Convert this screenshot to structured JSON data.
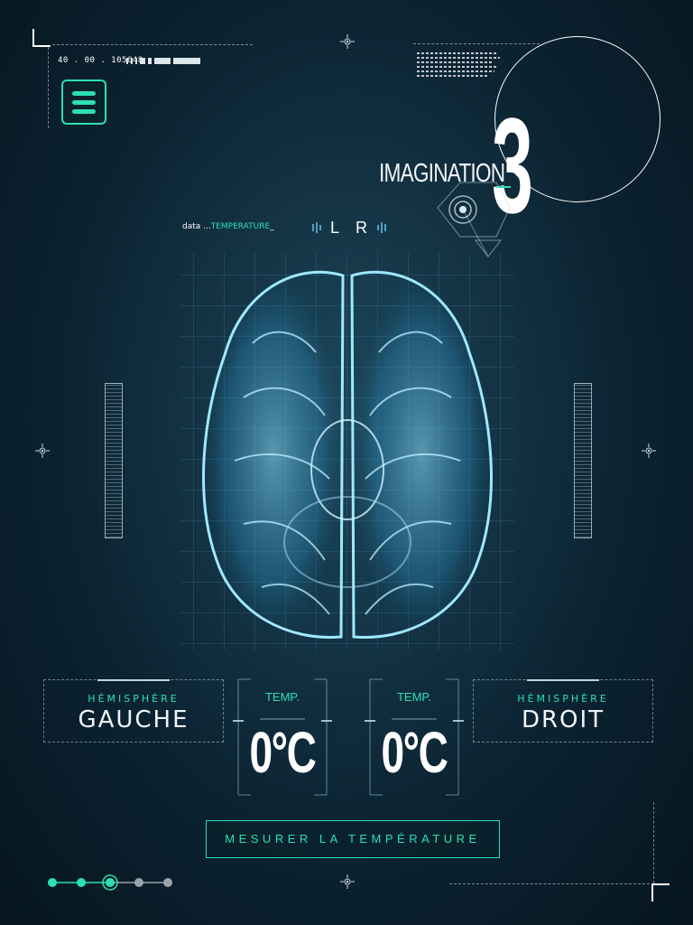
{
  "header": {
    "code": "40 . 00 . 105648",
    "title_word": "IMAGINATION",
    "title_number": "3",
    "menu_icon": "hamburger-menu-icon"
  },
  "data_label": {
    "prefix": "data ...",
    "value": "TEMPERATURE",
    "suffix": "_"
  },
  "hemispheres": {
    "left": {
      "small": "HÉMISPHÈRE",
      "big": "GAUCHE"
    },
    "right": {
      "small": "HÉMISPHÈRE",
      "big": "DROIT"
    }
  },
  "lr_toggle": {
    "left": "L",
    "right": "R"
  },
  "temperature": {
    "left": {
      "label": "TEMP.",
      "value": "0°C"
    },
    "right": {
      "label": "TEMP.",
      "value": "0°C"
    }
  },
  "actions": {
    "measure_label": "MESURER LA TEMPÉRATURE"
  },
  "progress": {
    "total_steps": 5,
    "current_step": 3
  },
  "colors": {
    "accent": "#2de0b3",
    "background": "#0b2230",
    "brain": "#7fd6ff"
  }
}
